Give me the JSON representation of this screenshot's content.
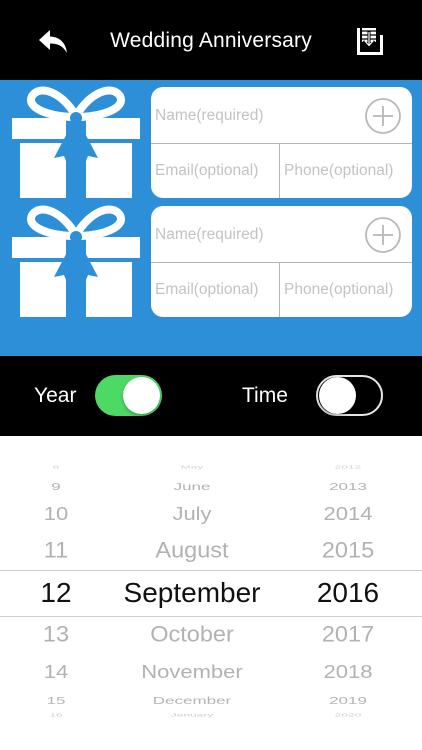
{
  "header": {
    "title": "Wedding Anniversary",
    "back_icon": "back-arrow-icon",
    "save_icon": "download-tray-icon"
  },
  "recipients": [
    {
      "icon": "gift-box-icon",
      "name_placeholder": "Name(required)",
      "email_placeholder": "Email(optional)",
      "phone_placeholder": "Phone(optional)",
      "add_icon": "plus-circle-icon"
    },
    {
      "icon": "gift-box-icon",
      "name_placeholder": "Name(required)",
      "email_placeholder": "Email(optional)",
      "phone_placeholder": "Phone(optional)",
      "add_icon": "plus-circle-icon"
    }
  ],
  "switches": {
    "year_label": "Year",
    "year_on": true,
    "time_label": "Time",
    "time_on": false
  },
  "picker": {
    "days": [
      "8",
      "9",
      "10",
      "11",
      "12",
      "13",
      "14",
      "15",
      "16"
    ],
    "months": [
      "May",
      "June",
      "July",
      "August",
      "September",
      "October",
      "November",
      "December",
      "January"
    ],
    "years": [
      "2012",
      "2013",
      "2014",
      "2015",
      "2016",
      "2017",
      "2018",
      "2019",
      "2020"
    ],
    "selected_index": 4
  },
  "colors": {
    "accent_blue": "#2e8fd9",
    "toggle_on": "#4cd964"
  }
}
